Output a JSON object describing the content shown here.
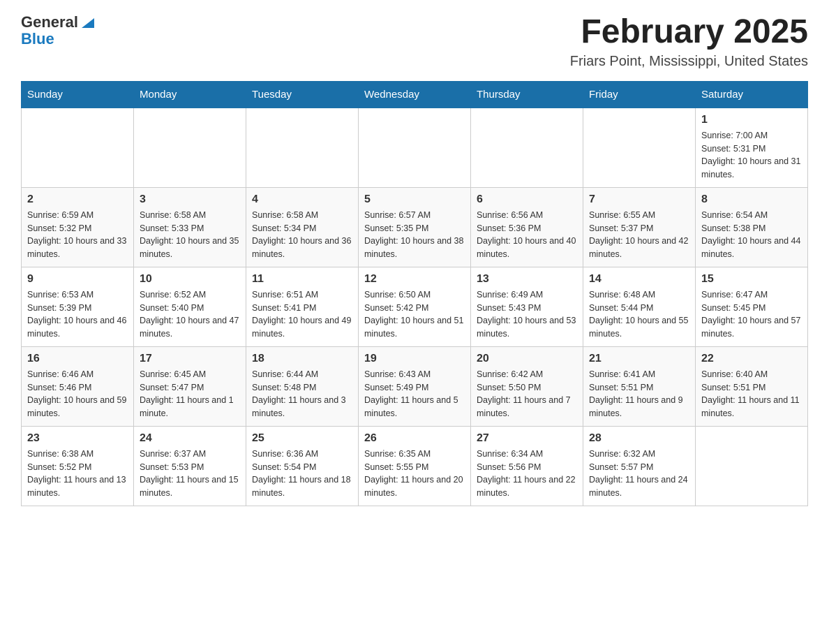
{
  "logo": {
    "text_general": "General",
    "text_blue": "Blue"
  },
  "title": "February 2025",
  "location": "Friars Point, Mississippi, United States",
  "days_of_week": [
    "Sunday",
    "Monday",
    "Tuesday",
    "Wednesday",
    "Thursday",
    "Friday",
    "Saturday"
  ],
  "weeks": [
    [
      {
        "day": "",
        "info": ""
      },
      {
        "day": "",
        "info": ""
      },
      {
        "day": "",
        "info": ""
      },
      {
        "day": "",
        "info": ""
      },
      {
        "day": "",
        "info": ""
      },
      {
        "day": "",
        "info": ""
      },
      {
        "day": "1",
        "info": "Sunrise: 7:00 AM\nSunset: 5:31 PM\nDaylight: 10 hours and 31 minutes."
      }
    ],
    [
      {
        "day": "2",
        "info": "Sunrise: 6:59 AM\nSunset: 5:32 PM\nDaylight: 10 hours and 33 minutes."
      },
      {
        "day": "3",
        "info": "Sunrise: 6:58 AM\nSunset: 5:33 PM\nDaylight: 10 hours and 35 minutes."
      },
      {
        "day": "4",
        "info": "Sunrise: 6:58 AM\nSunset: 5:34 PM\nDaylight: 10 hours and 36 minutes."
      },
      {
        "day": "5",
        "info": "Sunrise: 6:57 AM\nSunset: 5:35 PM\nDaylight: 10 hours and 38 minutes."
      },
      {
        "day": "6",
        "info": "Sunrise: 6:56 AM\nSunset: 5:36 PM\nDaylight: 10 hours and 40 minutes."
      },
      {
        "day": "7",
        "info": "Sunrise: 6:55 AM\nSunset: 5:37 PM\nDaylight: 10 hours and 42 minutes."
      },
      {
        "day": "8",
        "info": "Sunrise: 6:54 AM\nSunset: 5:38 PM\nDaylight: 10 hours and 44 minutes."
      }
    ],
    [
      {
        "day": "9",
        "info": "Sunrise: 6:53 AM\nSunset: 5:39 PM\nDaylight: 10 hours and 46 minutes."
      },
      {
        "day": "10",
        "info": "Sunrise: 6:52 AM\nSunset: 5:40 PM\nDaylight: 10 hours and 47 minutes."
      },
      {
        "day": "11",
        "info": "Sunrise: 6:51 AM\nSunset: 5:41 PM\nDaylight: 10 hours and 49 minutes."
      },
      {
        "day": "12",
        "info": "Sunrise: 6:50 AM\nSunset: 5:42 PM\nDaylight: 10 hours and 51 minutes."
      },
      {
        "day": "13",
        "info": "Sunrise: 6:49 AM\nSunset: 5:43 PM\nDaylight: 10 hours and 53 minutes."
      },
      {
        "day": "14",
        "info": "Sunrise: 6:48 AM\nSunset: 5:44 PM\nDaylight: 10 hours and 55 minutes."
      },
      {
        "day": "15",
        "info": "Sunrise: 6:47 AM\nSunset: 5:45 PM\nDaylight: 10 hours and 57 minutes."
      }
    ],
    [
      {
        "day": "16",
        "info": "Sunrise: 6:46 AM\nSunset: 5:46 PM\nDaylight: 10 hours and 59 minutes."
      },
      {
        "day": "17",
        "info": "Sunrise: 6:45 AM\nSunset: 5:47 PM\nDaylight: 11 hours and 1 minute."
      },
      {
        "day": "18",
        "info": "Sunrise: 6:44 AM\nSunset: 5:48 PM\nDaylight: 11 hours and 3 minutes."
      },
      {
        "day": "19",
        "info": "Sunrise: 6:43 AM\nSunset: 5:49 PM\nDaylight: 11 hours and 5 minutes."
      },
      {
        "day": "20",
        "info": "Sunrise: 6:42 AM\nSunset: 5:50 PM\nDaylight: 11 hours and 7 minutes."
      },
      {
        "day": "21",
        "info": "Sunrise: 6:41 AM\nSunset: 5:51 PM\nDaylight: 11 hours and 9 minutes."
      },
      {
        "day": "22",
        "info": "Sunrise: 6:40 AM\nSunset: 5:51 PM\nDaylight: 11 hours and 11 minutes."
      }
    ],
    [
      {
        "day": "23",
        "info": "Sunrise: 6:38 AM\nSunset: 5:52 PM\nDaylight: 11 hours and 13 minutes."
      },
      {
        "day": "24",
        "info": "Sunrise: 6:37 AM\nSunset: 5:53 PM\nDaylight: 11 hours and 15 minutes."
      },
      {
        "day": "25",
        "info": "Sunrise: 6:36 AM\nSunset: 5:54 PM\nDaylight: 11 hours and 18 minutes."
      },
      {
        "day": "26",
        "info": "Sunrise: 6:35 AM\nSunset: 5:55 PM\nDaylight: 11 hours and 20 minutes."
      },
      {
        "day": "27",
        "info": "Sunrise: 6:34 AM\nSunset: 5:56 PM\nDaylight: 11 hours and 22 minutes."
      },
      {
        "day": "28",
        "info": "Sunrise: 6:32 AM\nSunset: 5:57 PM\nDaylight: 11 hours and 24 minutes."
      },
      {
        "day": "",
        "info": ""
      }
    ]
  ]
}
